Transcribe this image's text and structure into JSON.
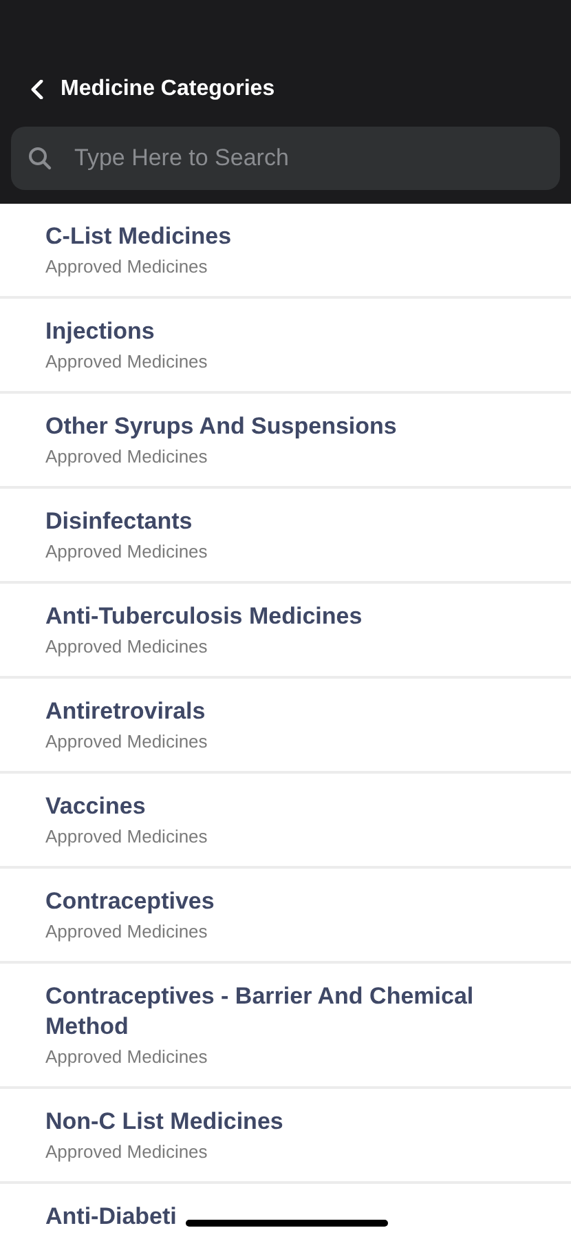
{
  "header": {
    "title": "Medicine Categories"
  },
  "search": {
    "placeholder": "Type Here to Search"
  },
  "categories": [
    {
      "name": "C-List Medicines",
      "subtitle": "Approved Medicines"
    },
    {
      "name": "Injections",
      "subtitle": "Approved Medicines"
    },
    {
      "name": "Other Syrups And Suspensions",
      "subtitle": "Approved Medicines"
    },
    {
      "name": "Disinfectants",
      "subtitle": "Approved Medicines"
    },
    {
      "name": "Anti-Tuberculosis Medicines",
      "subtitle": "Approved Medicines"
    },
    {
      "name": "Antiretrovirals",
      "subtitle": "Approved Medicines"
    },
    {
      "name": "Vaccines",
      "subtitle": "Approved Medicines"
    },
    {
      "name": "Contraceptives",
      "subtitle": "Approved Medicines"
    },
    {
      "name": "Contraceptives - Barrier And Chemical Method",
      "subtitle": "Approved Medicines"
    },
    {
      "name": "Non-C List Medicines",
      "subtitle": "Approved Medicines"
    },
    {
      "name": "Anti-Diabeti"
    }
  ]
}
